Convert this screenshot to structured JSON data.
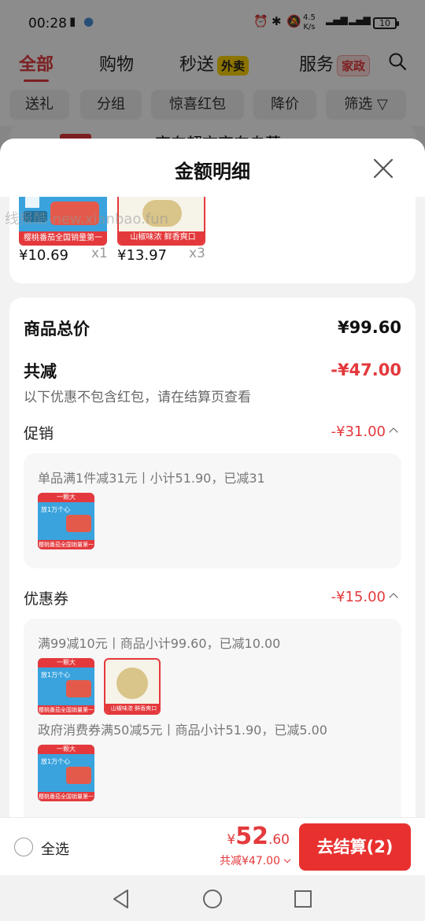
{
  "status_bar": {
    "time": "00:28",
    "net_speed_value": "4.5",
    "net_speed_unit": "K/s",
    "battery": "10"
  },
  "top_nav": {
    "tabs": [
      {
        "label": "全部",
        "active": true
      },
      {
        "label": "购物"
      },
      {
        "label": "秒送",
        "tag": "外卖"
      },
      {
        "label": "服务",
        "tag": "家政"
      }
    ]
  },
  "filters": [
    "送礼",
    "分组",
    "惊喜红包",
    "降价",
    "筛选"
  ],
  "background_item_text": "京东超市京东自营",
  "sheet": {
    "title": "金额明细",
    "products": [
      {
        "price": "¥10.69",
        "qty": "x1",
        "caption": "樱桃番茄全国销量第一"
      },
      {
        "price": "¥13.97",
        "qty": "x3",
        "caption": "山椒味浓 鲜香爽口"
      }
    ],
    "total_label": "商品总价",
    "total_value": "¥99.60",
    "discount_label": "共减",
    "discount_value": "-¥47.00",
    "discount_note": "以下优惠不包含红包，请在结算页查看",
    "promo": {
      "label": "促销",
      "value": "-¥31.00",
      "rule": "单品满1件减31元丨小计51.90，已减31"
    },
    "coupon": {
      "label": "优惠券",
      "value": "-¥15.00",
      "rule1": "满99减10元丨商品小计99.60，已减10.00",
      "rule2": "政府消费券满50减5元丨商品小计51.90，已减5.00"
    },
    "tomato_thumb": {
      "banner": "一颗大",
      "line1": "放1万个心",
      "caption": "樱桃番茄全国销量第一"
    },
    "pepper_thumb": {
      "caption": "山椒味浓 鲜香爽口"
    }
  },
  "bottom_bar": {
    "select_all": "全选",
    "currency": "¥",
    "total_int": "52",
    "total_dec": ".60",
    "saved": "共减¥47.00",
    "checkout": "去结算(2)"
  },
  "watermark": "线报酷-new.xianbao.fun",
  "colors": {
    "accent": "#e4393c",
    "button": "#e8312f",
    "tomato_blue": "#3aa3de"
  }
}
